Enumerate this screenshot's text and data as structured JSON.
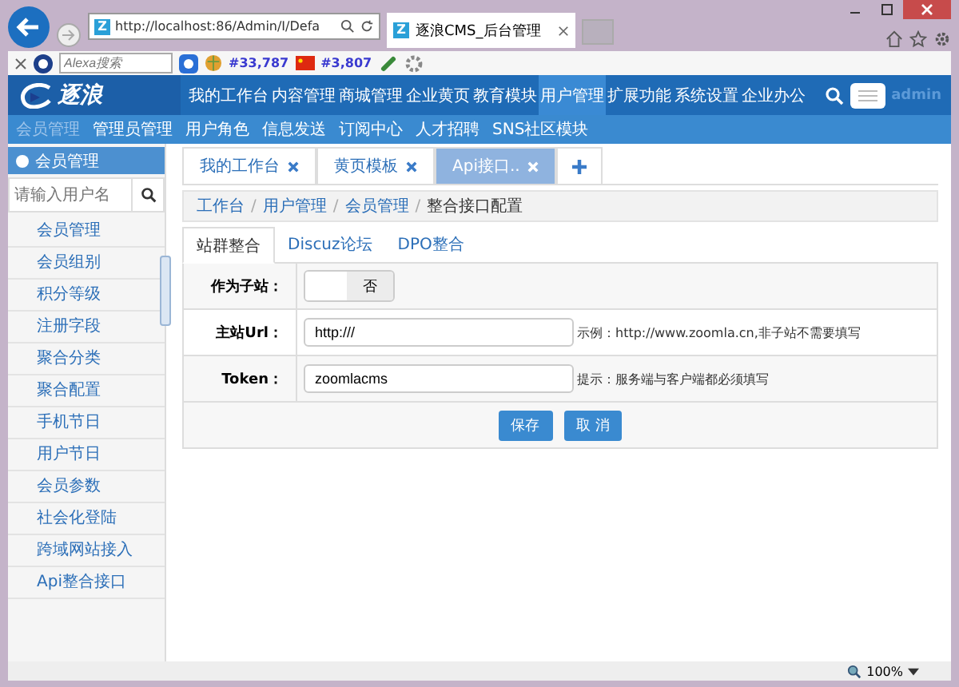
{
  "browser": {
    "favicons": [
      "Z",
      "Z"
    ],
    "address": "http://localhost:86/Admin/I/Defa",
    "tab_title": "逐浪CMS_后台管理",
    "search_placeholder": "Alexa搜索",
    "rank_global": "#33,787",
    "rank_china": "#3,807",
    "zoom": "100%"
  },
  "header": {
    "logo": "逐浪",
    "user": "admin",
    "nav": [
      {
        "label": "我的工作台",
        "selected": false
      },
      {
        "label": "内容管理",
        "selected": false
      },
      {
        "label": "商城管理",
        "selected": false
      },
      {
        "label": "企业黄页",
        "selected": false
      },
      {
        "label": "教育模块",
        "selected": false
      },
      {
        "label": "用户管理",
        "selected": true
      },
      {
        "label": "扩展功能",
        "selected": false
      },
      {
        "label": "系统设置",
        "selected": false
      },
      {
        "label": "企业办公",
        "selected": false
      }
    ],
    "subnav": [
      {
        "label": "会员管理",
        "selected": true
      },
      {
        "label": "管理员管理",
        "selected": false
      },
      {
        "label": "用户角色",
        "selected": false
      },
      {
        "label": "信息发送",
        "selected": false
      },
      {
        "label": "订阅中心",
        "selected": false
      },
      {
        "label": "人才招聘",
        "selected": false
      },
      {
        "label": "SNS社区模块",
        "selected": false
      }
    ]
  },
  "sidebar": {
    "title": "会员管理",
    "search_placeholder": "请输入用户名",
    "items": [
      {
        "label": "会员管理"
      },
      {
        "label": "会员组别"
      },
      {
        "label": "积分等级"
      },
      {
        "label": "注册字段"
      },
      {
        "label": "聚合分类"
      },
      {
        "label": "聚合配置"
      },
      {
        "label": "手机节日"
      },
      {
        "label": "用户节日"
      },
      {
        "label": "会员参数"
      },
      {
        "label": "社会化登陆"
      },
      {
        "label": "跨域网站接入"
      },
      {
        "label": "Api整合接口"
      }
    ]
  },
  "tabs": [
    {
      "label": "我的工作台",
      "selected": false
    },
    {
      "label": "黄页模板",
      "selected": false
    },
    {
      "label": "Api接口..",
      "selected": true
    }
  ],
  "breadcrumb": [
    {
      "label": "工作台"
    },
    {
      "separator": "/",
      "label": "用户管理"
    },
    {
      "separator": "/",
      "label": "会员管理"
    },
    {
      "separator": "/",
      "label": "整合接口配置"
    }
  ],
  "subtabs": [
    {
      "label": "站群整合",
      "selected": true
    },
    {
      "label": "Discuz论坛",
      "selected": false
    },
    {
      "label": "DPO整合",
      "selected": false
    }
  ],
  "form": [
    {
      "kind": "toggle",
      "label": "作为子站：",
      "on": false,
      "text": "否"
    },
    {
      "kind": "text",
      "label": "主站Url：",
      "value": "http:///",
      "hint": "示例：http://www.zoomla.cn,非子站不需要填写"
    },
    {
      "kind": "text",
      "label": "Token：",
      "value": "zoomlacms",
      "hint": "提示：服务端与客户端都必须填写"
    }
  ],
  "buttons": [
    "保存",
    "取 消"
  ]
}
